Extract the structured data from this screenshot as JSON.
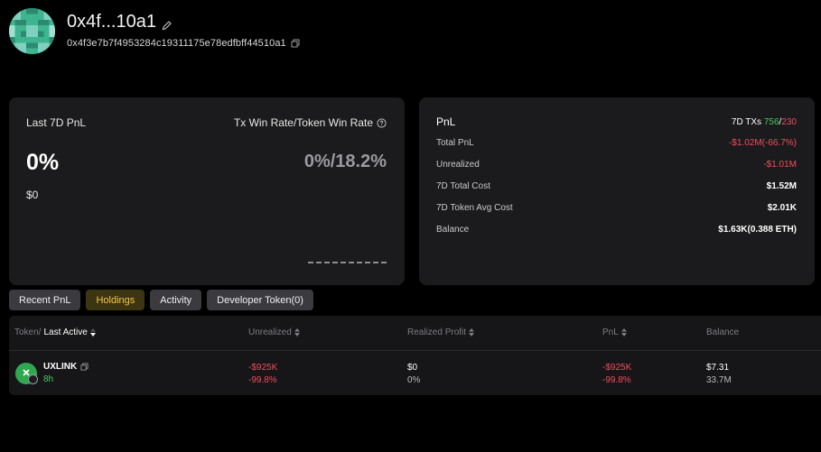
{
  "wallet": {
    "name": "0x4f...10a1",
    "address": "0x4f3e7b7f4953284c19311175e78edfbff44510a1"
  },
  "summary": {
    "pnl_label": "Last 7D PnL",
    "winrate_label": "Tx Win Rate/Token Win Rate",
    "pnl_percent": "0%",
    "winrate_value": "0%/18.2%",
    "pnl_amount": "$0"
  },
  "stats": {
    "title": "PnL",
    "txs_label": "7D TXs",
    "txs_wins": "756",
    "txs_sep": "/",
    "txs_losses": "230",
    "rows": [
      {
        "label": "Total PnL",
        "value": "-$1.02M(-66.7%)"
      },
      {
        "label": "Unrealized",
        "value": "-$1.01M"
      },
      {
        "label": "7D Total Cost",
        "value": "$1.52M"
      },
      {
        "label": "7D Token Avg Cost",
        "value": "$2.01K"
      },
      {
        "label": "Balance",
        "value": "$1.63K(0.388 ETH)"
      }
    ]
  },
  "tabs": [
    {
      "label": "Recent PnL",
      "active": false
    },
    {
      "label": "Holdings",
      "active": true
    },
    {
      "label": "Activity",
      "active": false
    },
    {
      "label": "Developer Token(0)",
      "active": false
    }
  ],
  "table": {
    "headers": {
      "token": "Token/",
      "last_active": "Last Active",
      "unrealized": "Unrealized",
      "realized": "Realized Profit",
      "pnl": "PnL",
      "balance": "Balance"
    },
    "rows": [
      {
        "token": "UXLINK",
        "time": "8h",
        "unrealized": "-$925K",
        "unrealized_pct": "-99.8%",
        "realized": "$0",
        "realized_pct": "0%",
        "pnl": "-$925K",
        "pnl_pct": "-99.8%",
        "balance": "$7.31",
        "balance_qty": "33.7M"
      }
    ]
  },
  "colors": {
    "positive": "#4cc766",
    "negative": "#f04c5c",
    "accent": "#f5c74a"
  }
}
